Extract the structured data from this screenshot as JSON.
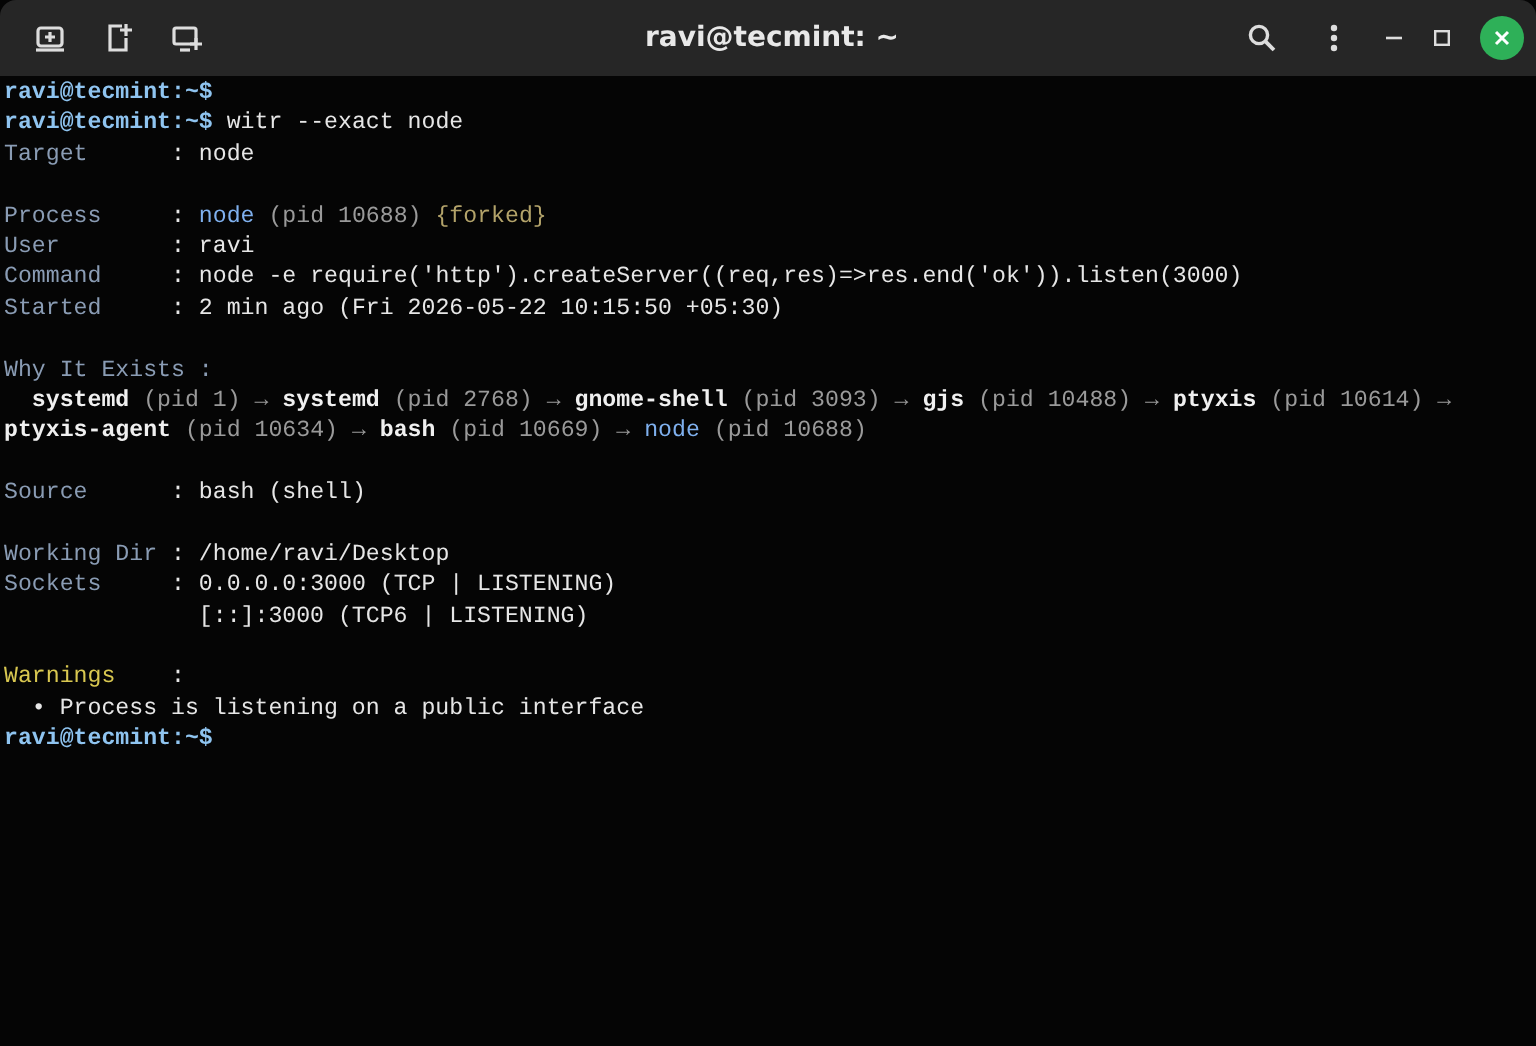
{
  "window": {
    "title": "ravi@tecmint: ~"
  },
  "terminal": {
    "lines": [
      {
        "kind": "text",
        "segments": [
          {
            "kind": "prompt",
            "text": "ravi@tecmint:~$"
          }
        ]
      },
      {
        "kind": "text",
        "segments": [
          {
            "kind": "prompt",
            "text": "ravi@tecmint:~$"
          },
          {
            "kind": "value",
            "text": " witr --exact node"
          }
        ]
      },
      {
        "kind": "text",
        "segments": [
          {
            "kind": "label",
            "text": "Target      "
          },
          {
            "kind": "value",
            "text": ": node"
          }
        ]
      },
      {
        "kind": "blank"
      },
      {
        "kind": "text",
        "segments": [
          {
            "kind": "label",
            "text": "Process     "
          },
          {
            "kind": "value",
            "text": ": "
          },
          {
            "kind": "accent",
            "text": "node"
          },
          {
            "kind": "dim",
            "text": " (pid 10688) "
          },
          {
            "kind": "note",
            "text": "{forked}"
          }
        ]
      },
      {
        "kind": "text",
        "segments": [
          {
            "kind": "label",
            "text": "User        "
          },
          {
            "kind": "value",
            "text": ": ravi"
          }
        ]
      },
      {
        "kind": "text",
        "segments": [
          {
            "kind": "label",
            "text": "Command     "
          },
          {
            "kind": "value",
            "text": ": node -e require('http').createServer((req,res)=>res.end('ok')).listen(3000)"
          }
        ]
      },
      {
        "kind": "text",
        "segments": [
          {
            "kind": "label",
            "text": "Started     "
          },
          {
            "kind": "value",
            "text": ": 2 min ago (Fri 2026-05-22 10:15:50 +05:30)"
          }
        ]
      },
      {
        "kind": "blank"
      },
      {
        "kind": "text",
        "segments": [
          {
            "kind": "label",
            "text": "Why It Exists :"
          }
        ]
      },
      {
        "kind": "text",
        "segments": [
          {
            "kind": "bold",
            "text": "  systemd"
          },
          {
            "kind": "dim",
            "text": " (pid 1) → "
          },
          {
            "kind": "bold",
            "text": "systemd"
          },
          {
            "kind": "dim",
            "text": " (pid 2768) → "
          },
          {
            "kind": "bold",
            "text": "gnome-shell"
          },
          {
            "kind": "dim",
            "text": " (pid 3093) → "
          },
          {
            "kind": "bold",
            "text": "gjs"
          },
          {
            "kind": "dim",
            "text": " (pid 10488) → "
          },
          {
            "kind": "bold",
            "text": "ptyxis"
          },
          {
            "kind": "dim",
            "text": " (pid 10614) →"
          }
        ]
      },
      {
        "kind": "text",
        "segments": [
          {
            "kind": "bold",
            "text": "ptyxis-agent"
          },
          {
            "kind": "dim",
            "text": " (pid 10634) → "
          },
          {
            "kind": "bold",
            "text": "bash"
          },
          {
            "kind": "dim",
            "text": " (pid 10669) → "
          },
          {
            "kind": "accent",
            "text": "node"
          },
          {
            "kind": "dim",
            "text": " (pid 10688)"
          }
        ]
      },
      {
        "kind": "blank"
      },
      {
        "kind": "text",
        "segments": [
          {
            "kind": "label",
            "text": "Source      "
          },
          {
            "kind": "value",
            "text": ": bash (shell)"
          }
        ]
      },
      {
        "kind": "blank"
      },
      {
        "kind": "text",
        "segments": [
          {
            "kind": "label",
            "text": "Working Dir "
          },
          {
            "kind": "value",
            "text": ": /home/ravi/Desktop"
          }
        ]
      },
      {
        "kind": "text",
        "segments": [
          {
            "kind": "label",
            "text": "Sockets     "
          },
          {
            "kind": "value",
            "text": ": 0.0.0.0:3000 (TCP | LISTENING)"
          }
        ]
      },
      {
        "kind": "text",
        "segments": [
          {
            "kind": "value",
            "text": "              [::]:3000 (TCP6 | LISTENING)"
          }
        ]
      },
      {
        "kind": "blank"
      },
      {
        "kind": "text",
        "segments": [
          {
            "kind": "warn",
            "text": "Warnings    "
          },
          {
            "kind": "value",
            "text": ":"
          }
        ]
      },
      {
        "kind": "text",
        "segments": [
          {
            "kind": "value",
            "text": "  • Process is listening on a public interface"
          }
        ]
      },
      {
        "kind": "text",
        "segments": [
          {
            "kind": "prompt",
            "text": "ravi@tecmint:~$"
          }
        ]
      }
    ]
  }
}
